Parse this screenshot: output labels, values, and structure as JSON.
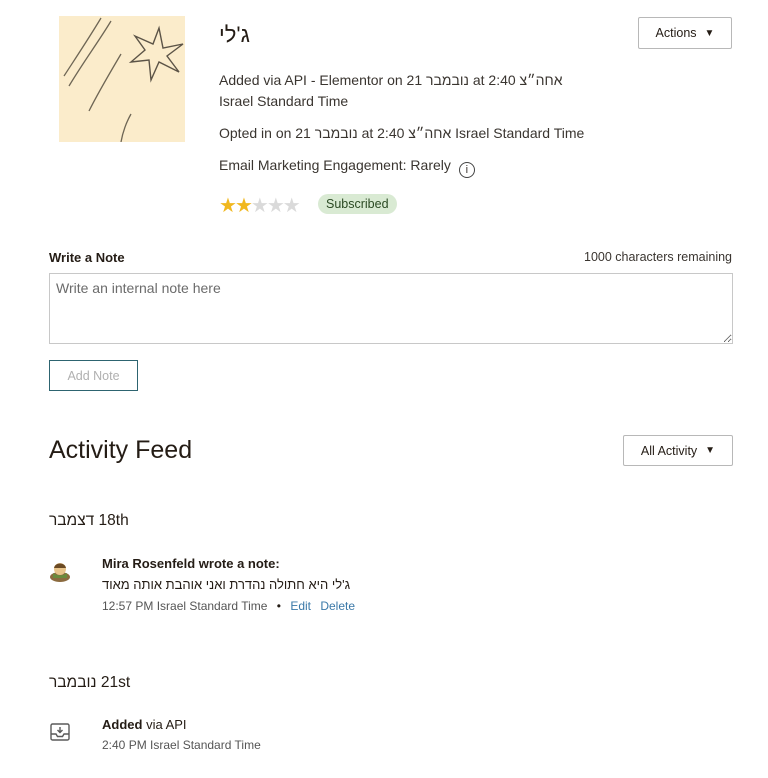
{
  "contact": {
    "name": "ג'לי",
    "added_line1": "Added via API - Elementor on 21 נובמבר at 2:40 אחה״צ",
    "added_line2": "Israel Standard Time",
    "opted_in": "Opted in on 21 נובמבר at 2:40 אחה״צ Israel Standard Time",
    "engagement": "Email Marketing Engagement: Rarely",
    "rating": 2,
    "rating_max": 5,
    "status_badge": "Subscribed"
  },
  "header": {
    "actions_label": "Actions"
  },
  "note": {
    "label": "Write a Note",
    "remaining": "1000 characters remaining",
    "placeholder": "Write an internal note here",
    "value": "",
    "add_button": "Add Note"
  },
  "feed": {
    "title": "Activity Feed",
    "filter_label": "All Activity",
    "groups": [
      {
        "date": "18 דצמבר",
        "items": [
          {
            "icon": "user-avatar-icon",
            "author": "Mira Rosenfeld wrote a note:",
            "body": "ג'לי היא חתולה נהדרת ואני אוהבת אותה מאוד",
            "time": "12:57 PM Israel Standard Time",
            "separator": "•",
            "edit": "Edit",
            "delete": "Delete"
          }
        ]
      },
      {
        "date": "21 נובמבר",
        "items": [
          {
            "icon": "download-tray-icon",
            "title_bold": "Added",
            "title_rest": " via API",
            "time": "2:40 PM Israel Standard Time"
          }
        ]
      }
    ]
  },
  "colors": {
    "star": "#f1b81f",
    "badge_bg": "#d9ead3",
    "link": "#3a78a8",
    "button_border": "#2d6470"
  }
}
